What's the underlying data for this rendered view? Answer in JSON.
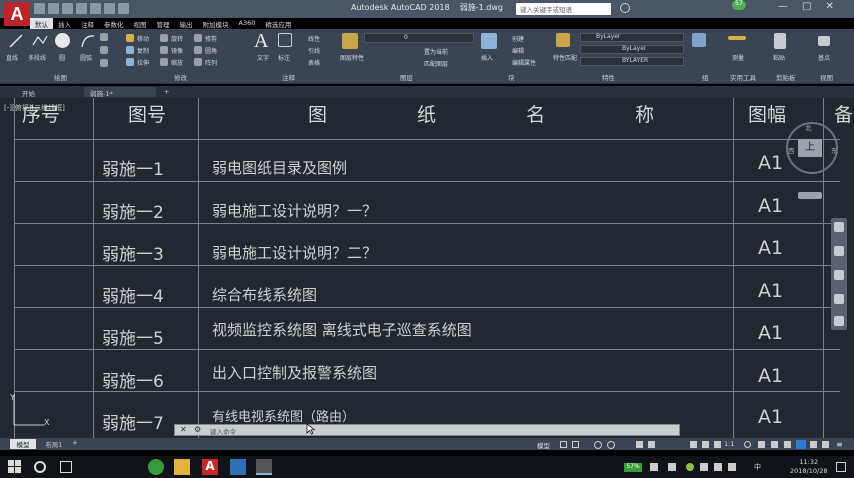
{
  "app": {
    "title": "Autodesk AutoCAD 2018    弱施-1.dwg",
    "search_placeholder": "键入关键字或短语",
    "window_buttons": [
      "—",
      "□",
      "✕"
    ]
  },
  "ribbon_tabs": [
    "默认",
    "插入",
    "注释",
    "参数化",
    "视图",
    "管理",
    "输出",
    "附加模块",
    "A360",
    "精选应用"
  ],
  "ribbon": {
    "draw": {
      "line": "直线",
      "polyline": "多段线",
      "circle": "圆",
      "arc": "圆弧"
    },
    "modify": {
      "move": "移动",
      "rotate": "旋转",
      "copy": "复制",
      "mirror": "镜像",
      "stretch": "拉伸",
      "scale": "缩放",
      "array": "阵列",
      "trim": "修剪",
      "fillet": "圆角"
    },
    "annotation": {
      "text": "文字",
      "dimension": "标注",
      "linear": "线性",
      "leader": "引线",
      "table": "表格"
    },
    "layers": {
      "layer_props": "图层特性",
      "current_layer": "0",
      "make_current": "置为当前",
      "match_layer": "匹配图层"
    },
    "block": {
      "insert": "插入",
      "create": "创建",
      "edit": "编辑",
      "edit_attr": "编辑属性"
    },
    "properties": {
      "match": "特性匹配",
      "color": "ByLayer",
      "linetype": "ByLayer",
      "lineweight": "BYLAYER"
    },
    "groups": {
      "group": "组"
    },
    "utilities": {
      "measure": "测量"
    },
    "clipboard": {
      "paste": "粘贴"
    },
    "view": {
      "base": "基点"
    }
  },
  "panel_titles": [
    "绘图",
    "修改",
    "注释",
    "图层",
    "块",
    "特性",
    "组",
    "实用工具",
    "剪贴板",
    "视图"
  ],
  "doc_tabs": [
    "开始",
    "弱施-1*",
    "+"
  ],
  "viewport_label": "[-][俯视][二维线框]",
  "viewcube": {
    "top": "上",
    "north": "北",
    "west": "西",
    "east": "东"
  },
  "table": {
    "headers": {
      "no": "序号",
      "sheet": "图号",
      "name": "图 纸 名 称",
      "size": "图幅",
      "remark": "备"
    },
    "rows": [
      {
        "sheet": "弱施一1",
        "name": "弱电图纸目录及图例",
        "size": "A1"
      },
      {
        "sheet": "弱施一2",
        "name": "弱电施工设计说明？一？",
        "size": "A1"
      },
      {
        "sheet": "弱施一3",
        "name": "弱电施工设计说明？二？",
        "size": "A1"
      },
      {
        "sheet": "弱施一4",
        "name": "综合布线系统图",
        "size": "A1"
      },
      {
        "sheet": "弱施一5",
        "name": "视频监控系统图  离线式电子巡查系统图",
        "size": "A1"
      },
      {
        "sheet": "弱施一6",
        "name": "出入口控制及报警系统图",
        "size": "A1"
      },
      {
        "sheet": "弱施一7",
        "name": "有线电视系统图（路由）",
        "size": "A1"
      }
    ]
  },
  "command_placeholder": "键入命令",
  "layout_tabs": [
    "模型",
    "布局1",
    "+"
  ],
  "status": {
    "model": "模型",
    "scale": "1:1"
  },
  "taskbar": {
    "time": "11:32",
    "date": "2018/10/28",
    "battery": "57%",
    "ime": "中"
  },
  "colors": {
    "canvas": "#212830",
    "ribbon": "#3b4453",
    "title": "#4a5566",
    "accent": "#b8262b"
  }
}
